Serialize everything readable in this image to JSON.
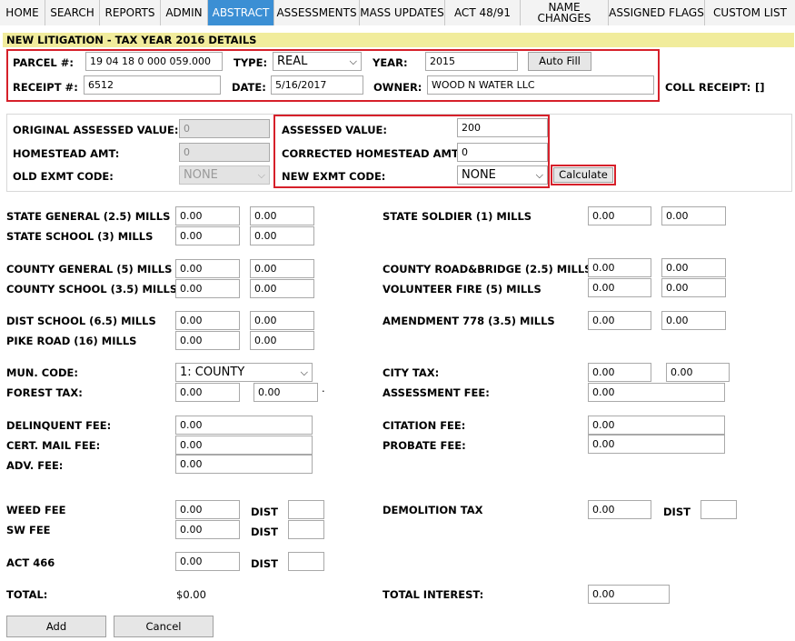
{
  "nav": {
    "tabs": [
      {
        "label": "HOME"
      },
      {
        "label": "SEARCH"
      },
      {
        "label": "REPORTS"
      },
      {
        "label": "ADMIN"
      },
      {
        "label": "ABSTRACT"
      },
      {
        "label": "ASSESSMENTS"
      },
      {
        "label": "MASS UPDATES"
      },
      {
        "label": "ACT 48/91"
      },
      {
        "label": "NAME CHANGES"
      },
      {
        "label": "ASSIGNED FLAGS"
      },
      {
        "label": "CUSTOM LIST"
      }
    ],
    "active_tab": "ABSTRACT",
    "active_color": "#3b8fd4"
  },
  "header": {
    "title": "NEW LITIGATION - TAX YEAR 2016 DETAILS",
    "bg_color": "#f1ec9c"
  },
  "parcel": {
    "parcel_label": "PARCEL #:",
    "parcel_value": "19 04 18 0 000 059.000",
    "type_label": "TYPE:",
    "type_value": "REAL",
    "year_label": "YEAR:",
    "year_value": "2015",
    "autofill_label": "Auto Fill",
    "receipt_label": "RECEIPT #:",
    "receipt_value": "6512",
    "date_label": "DATE:",
    "date_value": "5/16/2017",
    "owner_label": "OWNER:",
    "owner_value": "WOOD N WATER LLC",
    "coll_receipt_label": "COLL RECEIPT:",
    "coll_receipt_value": "[]"
  },
  "assessment": {
    "orig_label": "ORIGINAL ASSESSED VALUE:",
    "orig_value": "0",
    "homestead_label": "HOMESTEAD AMT:",
    "homestead_value": "0",
    "old_exmt_label": "OLD EXMT CODE:",
    "old_exmt_value": "NONE",
    "assessed_label": "ASSESSED VALUE:",
    "assessed_value": "200",
    "corr_homestead_label": "CORRECTED HOMESTEAD AMT:",
    "corr_homestead_value": "0",
    "new_exmt_label": "NEW EXMT CODE:",
    "new_exmt_value": "NONE",
    "calculate_label": "Calculate"
  },
  "mills_left": [
    {
      "label": "STATE GENERAL (2.5) MILLS",
      "v1": "0.00",
      "v2": "0.00"
    },
    {
      "label": "STATE SCHOOL (3) MILLS",
      "v1": "0.00",
      "v2": "0.00"
    },
    {
      "label": "COUNTY GENERAL (5) MILLS",
      "v1": "0.00",
      "v2": "0.00"
    },
    {
      "label": "COUNTY SCHOOL (3.5) MILLS",
      "v1": "0.00",
      "v2": "0.00"
    },
    {
      "label": "DIST SCHOOL (6.5) MILLS",
      "v1": "0.00",
      "v2": "0.00"
    },
    {
      "label": "PIKE ROAD (16) MILLS",
      "v1": "0.00",
      "v2": "0.00"
    }
  ],
  "mills_right": [
    {
      "label": "STATE SOLDIER (1) MILLS",
      "v1": "0.00",
      "v2": "0.00"
    },
    {
      "label": "COUNTY ROAD&BRIDGE (2.5) MILLS",
      "v1": "0.00",
      "v2": "0.00"
    },
    {
      "label": "VOLUNTEER FIRE (5) MILLS",
      "v1": "0.00",
      "v2": "0.00"
    },
    {
      "label": "AMENDMENT 778 (3.5) MILLS",
      "v1": "0.00",
      "v2": "0.00"
    }
  ],
  "misc": {
    "mun_code_label": "MUN. CODE:",
    "mun_code_value": "1: COUNTY",
    "forest_tax_label": "FOREST TAX:",
    "forest_v1": "0.00",
    "forest_v2": "0.00",
    "forest_dot": ".",
    "city_tax_label": "CITY TAX:",
    "city_v1": "0.00",
    "city_v2": "0.00",
    "assessment_fee_label": "ASSESSMENT FEE:",
    "assessment_fee_value": "0.00",
    "delinquent_label": "DELINQUENT FEE:",
    "delinquent_value": "0.00",
    "cert_mail_label": "CERT. MAIL FEE:",
    "cert_mail_value": "0.00",
    "adv_fee_label": "ADV. FEE:",
    "adv_fee_value": "0.00",
    "citation_label": "CITATION FEE:",
    "citation_value": "0.00",
    "probate_label": "PROBATE FEE:",
    "probate_value": "0.00"
  },
  "fees": {
    "weed_label": "WEED FEE",
    "weed_value": "0.00",
    "sw_label": "SW FEE",
    "sw_value": "0.00",
    "act466_label": "ACT 466",
    "act466_value": "0.00",
    "dist_label": "DIST",
    "demolition_label": "DEMOLITION TAX",
    "demolition_value": "0.00"
  },
  "totals": {
    "total_label": "TOTAL:",
    "total_value": "$0.00",
    "interest_label": "TOTAL INTEREST:",
    "interest_value": "0.00"
  },
  "actions": {
    "add_label": "Add",
    "cancel_label": "Cancel"
  },
  "highlight_color": "#d6202a"
}
